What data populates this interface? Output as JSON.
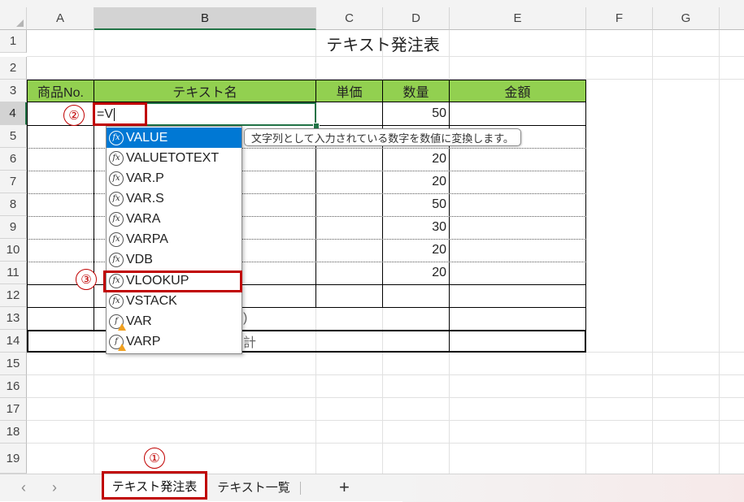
{
  "columns": [
    "A",
    "B",
    "C",
    "D",
    "E",
    "F",
    "G"
  ],
  "rows": [
    "1",
    "2",
    "3",
    "4",
    "5",
    "6",
    "7",
    "8",
    "9",
    "10",
    "11",
    "12",
    "13",
    "14",
    "15",
    "16",
    "17",
    "18",
    "19"
  ],
  "sheet": {
    "title": "テキスト発注表",
    "headers": [
      "商品No.",
      "テキスト名",
      "単価",
      "数量",
      "金額"
    ],
    "header_color": "#92d050",
    "active_cell_input": "=V",
    "quantities": [
      "50",
      "",
      "20",
      "20",
      "50",
      "30",
      "20",
      "20"
    ],
    "row13_b_fragment": ")",
    "total_fragment": "計"
  },
  "autocomplete": {
    "items": [
      {
        "label": "VALUE",
        "icon": "function-icon",
        "selected": true
      },
      {
        "label": "VALUETOTEXT",
        "icon": "function-icon"
      },
      {
        "label": "VAR.P",
        "icon": "function-icon"
      },
      {
        "label": "VAR.S",
        "icon": "function-icon"
      },
      {
        "label": "VARA",
        "icon": "function-icon"
      },
      {
        "label": "VARPA",
        "icon": "function-icon"
      },
      {
        "label": "VDB",
        "icon": "function-icon"
      },
      {
        "label": "VLOOKUP",
        "icon": "function-icon"
      },
      {
        "label": "VSTACK",
        "icon": "function-icon"
      },
      {
        "label": "VAR",
        "icon": "function-warning-icon"
      },
      {
        "label": "VARP",
        "icon": "function-warning-icon"
      }
    ],
    "tooltip": "文字列として入力されている数字を数値に変換します。",
    "highlight_color": "#0078d4"
  },
  "annotations": {
    "step1": "①",
    "step2": "②",
    "step3": "③",
    "color": "#c00000"
  },
  "tabs": {
    "sheets": [
      "テキスト発注表",
      "テキスト一覧"
    ],
    "add": "+",
    "prev": "‹",
    "next": "›"
  }
}
